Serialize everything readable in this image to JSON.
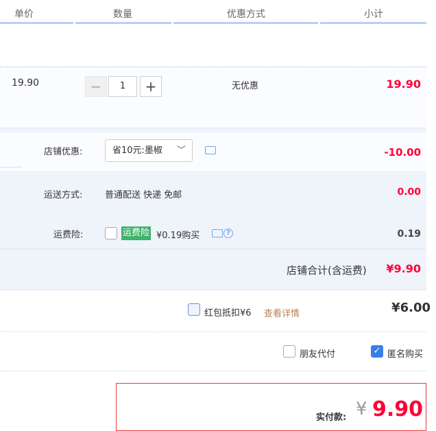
{
  "header": {
    "col_price": "单价",
    "col_qty": "数量",
    "col_discount": "优惠方式",
    "col_subtotal": "小计"
  },
  "item": {
    "unit_price": "19.90",
    "quantity": "1",
    "discount": "无优惠",
    "subtotal": "19.90"
  },
  "shop": {
    "coupon_label": "店铺优惠:",
    "coupon_selected": "省10元:墨椒",
    "coupon_value": "-10.00",
    "shipping_label": "运送方式:",
    "shipping_text": "普通配送 快递 免邮",
    "shipping_value": "0.00",
    "insurance_label": "运费险:",
    "insurance_badge": "运费险",
    "insurance_price": "¥0.19购买",
    "insurance_value": "0.19",
    "total_label": "店铺合计(含运费)",
    "total_value": "¥9.90"
  },
  "redpacket": {
    "label": "红包抵扣¥6",
    "details_link": "查看详情",
    "value": "¥6.00"
  },
  "options": {
    "friend_pay": "朋友代付",
    "anonymous": "匿名购买",
    "anonymous_checked": true
  },
  "payment": {
    "label": "实付款:",
    "currency": "¥",
    "amount": "9.90"
  },
  "colors": {
    "price_red": "#ff0036",
    "accent_blue": "#3a7fe8",
    "header_line": "#b2d1ff"
  }
}
